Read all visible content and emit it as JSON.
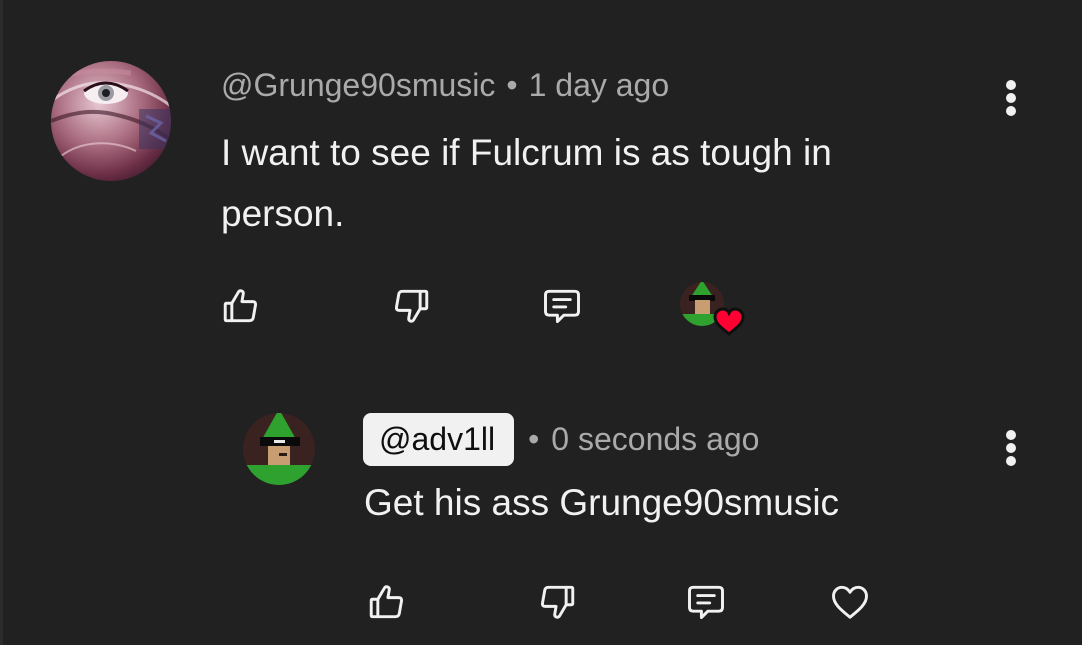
{
  "comment": {
    "author": "@Grunge90smusic",
    "separator": "•",
    "time": "1 day ago",
    "text": "I want to see if Fulcrum is as tough in person.",
    "avatar_icon": "distorted-face-avatar-icon",
    "actions": [
      "thumbs-up-icon",
      "thumbs-down-icon",
      "reply-comment-icon",
      "creator-heart-badge"
    ],
    "menu_icon": "more-vertical-icon"
  },
  "reply": {
    "author": "@adv1ll",
    "separator": "•",
    "time": "0 seconds ago",
    "text": "Get his ass Grunge90smusic",
    "avatar_icon": "green-elf-hat-avatar-icon",
    "actions": [
      "thumbs-up-icon",
      "thumbs-down-icon",
      "reply-comment-icon",
      "heart-outline-icon"
    ],
    "menu_icon": "more-vertical-icon"
  },
  "colors": {
    "background": "#212121",
    "primary_text": "#f1f1f1",
    "secondary_text": "#aaaaaa",
    "heart_red": "#ff0033",
    "handle_chip_bg": "#f1f1f1"
  }
}
